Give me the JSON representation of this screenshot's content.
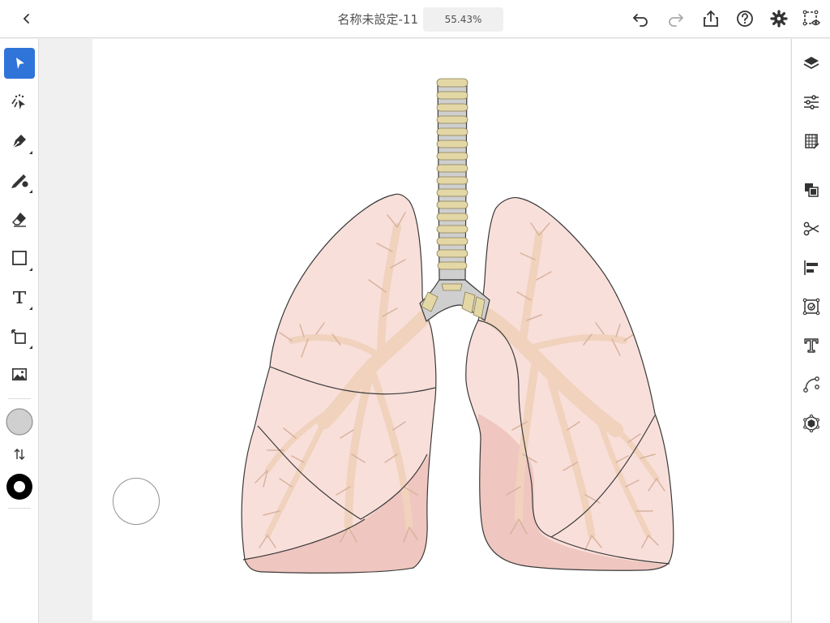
{
  "header": {
    "document_title": "名称未設定-11",
    "zoom_level": "55.43%"
  },
  "colors": {
    "accent": "#2f74d9",
    "lung_fill": "#f9dfda",
    "lung_lower_fill": "#efc6c0",
    "bronchi_fill": "#f0d2bd",
    "cartilage_gray": "#cfcfcf",
    "cartilage_tan": "#e3d7a6",
    "outline": "#3a3a3a"
  },
  "left_toolbar": {
    "tools": [
      {
        "name": "selection-tool",
        "icon": "arrow-pointer-icon",
        "active": true
      },
      {
        "name": "direct-selection-tool",
        "icon": "direct-select-icon",
        "active": false
      },
      {
        "name": "pen-tool",
        "icon": "pen-nib-icon",
        "active": false
      },
      {
        "name": "pencil-brush-tool",
        "icon": "pencil-brush-icon",
        "active": false
      },
      {
        "name": "eraser-tool",
        "icon": "eraser-icon",
        "active": false
      },
      {
        "name": "shape-tool",
        "icon": "rectangle-icon",
        "active": false
      },
      {
        "name": "type-tool",
        "icon": "type-icon",
        "active": false
      },
      {
        "name": "transform-tool",
        "icon": "transform-icon",
        "active": false
      },
      {
        "name": "image-place-tool",
        "icon": "image-icon",
        "active": false
      }
    ],
    "fill_color": "#d0d0d0",
    "stroke_color": "#000000"
  },
  "right_panel": {
    "icons": [
      "layers-icon",
      "properties-sliders-icon",
      "grid-icon",
      "arrange-icon",
      "scissors-icon",
      "align-icon",
      "repeat-icon",
      "type-panel-icon",
      "path-icon",
      "appearance-icon"
    ]
  }
}
